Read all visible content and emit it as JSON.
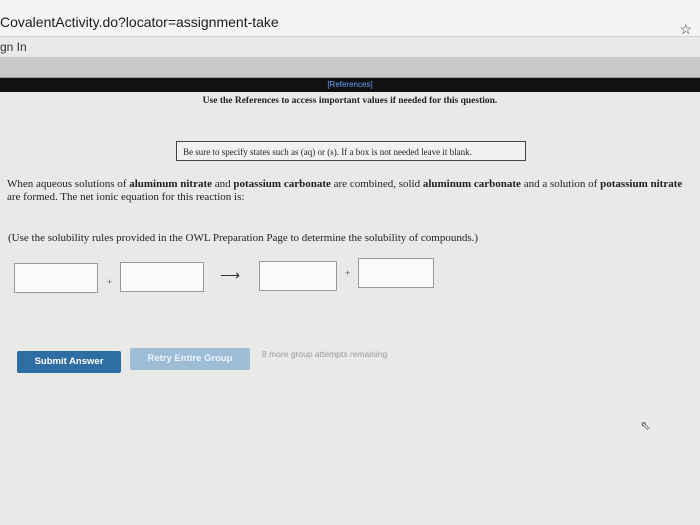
{
  "browser": {
    "url": "CovalentActivity.do?locator=assignment-take",
    "bookmark_icon": "star-icon",
    "sign_in": "gn In"
  },
  "references": {
    "link": "[References]",
    "note": "Use the References to access important values if needed for this question."
  },
  "hint": "Be sure to specify states such as (aq) or (s). If a box is not needed leave it blank.",
  "question": {
    "p1": "When aqueous solutions of ",
    "b1": "aluminum nitrate",
    "p2": " and ",
    "b2": "potassium carbonate",
    "p3": " are combined, solid ",
    "b3": "aluminum carbonate",
    "p4": " and a solution of ",
    "b4": "potassium nitrate",
    "p5": " are formed. The net ionic equation for this reaction is:"
  },
  "solubility_note": "(Use the solubility rules provided in the OWL Preparation Page to determine the solubility of compounds.)",
  "equation": {
    "plus": "+",
    "arrow": "⟶"
  },
  "buttons": {
    "submit": "Submit Answer",
    "retry": "Retry Entire Group"
  },
  "attempts": "8 more group attempts remaining"
}
